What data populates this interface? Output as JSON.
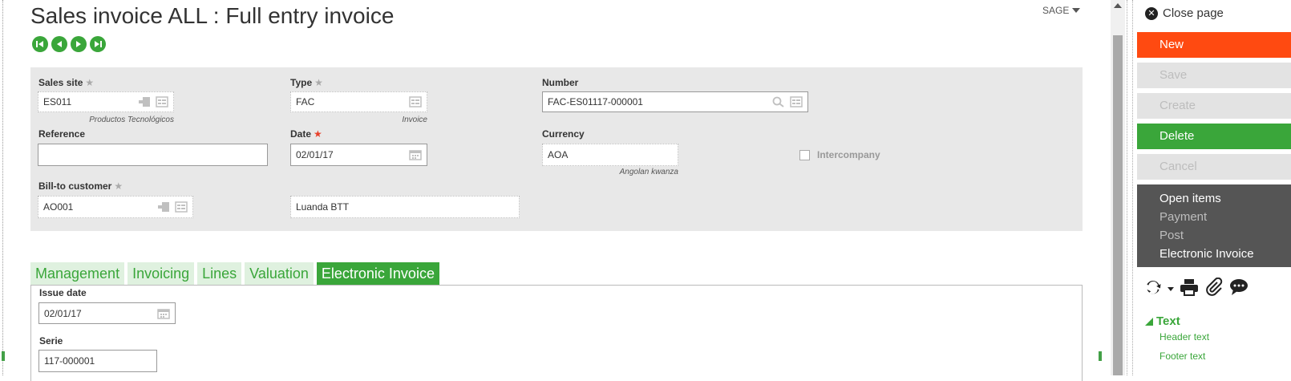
{
  "page": {
    "title": "Sales invoice ALL : Full entry invoice",
    "folder": "SAGE"
  },
  "header": {
    "sales_site": {
      "label": "Sales site",
      "value": "ES011",
      "sub": "Productos Tecnológicos"
    },
    "type": {
      "label": "Type",
      "value": "FAC",
      "sub": "Invoice"
    },
    "number": {
      "label": "Number",
      "value": "FAC-ES01117-000001"
    },
    "reference": {
      "label": "Reference",
      "value": ""
    },
    "date": {
      "label": "Date",
      "value": "02/01/17"
    },
    "currency": {
      "label": "Currency",
      "value": "AOA",
      "sub": "Angolan kwanza"
    },
    "intercompany": {
      "label": "Intercompany",
      "checked": false
    },
    "bill_to": {
      "label": "Bill-to customer",
      "value": "AO001",
      "name": "Luanda BTT"
    }
  },
  "tabs": [
    {
      "label": "Management",
      "active": false
    },
    {
      "label": "Invoicing",
      "active": false
    },
    {
      "label": "Lines",
      "active": false
    },
    {
      "label": "Valuation",
      "active": false
    },
    {
      "label": "Electronic Invoice",
      "active": true
    }
  ],
  "einvoice": {
    "issue_date": {
      "label": "Issue date",
      "value": "02/01/17"
    },
    "serie": {
      "label": "Serie",
      "value": "117-000001"
    }
  },
  "sidebar": {
    "close_label": "Close page",
    "buttons": {
      "new": "New",
      "save": "Save",
      "create": "Create",
      "delete": "Delete",
      "cancel": "Cancel"
    },
    "menu": [
      "Open items",
      "Payment",
      "Post",
      "Electronic Invoice"
    ],
    "text_section": {
      "title": "Text",
      "links": [
        "Header text",
        "Footer text"
      ]
    }
  },
  "colors": {
    "accent_green": "#3aa63a",
    "new_orange": "#ff4a11",
    "dark_menu": "#555555",
    "form_bg": "#e8e8e8"
  }
}
